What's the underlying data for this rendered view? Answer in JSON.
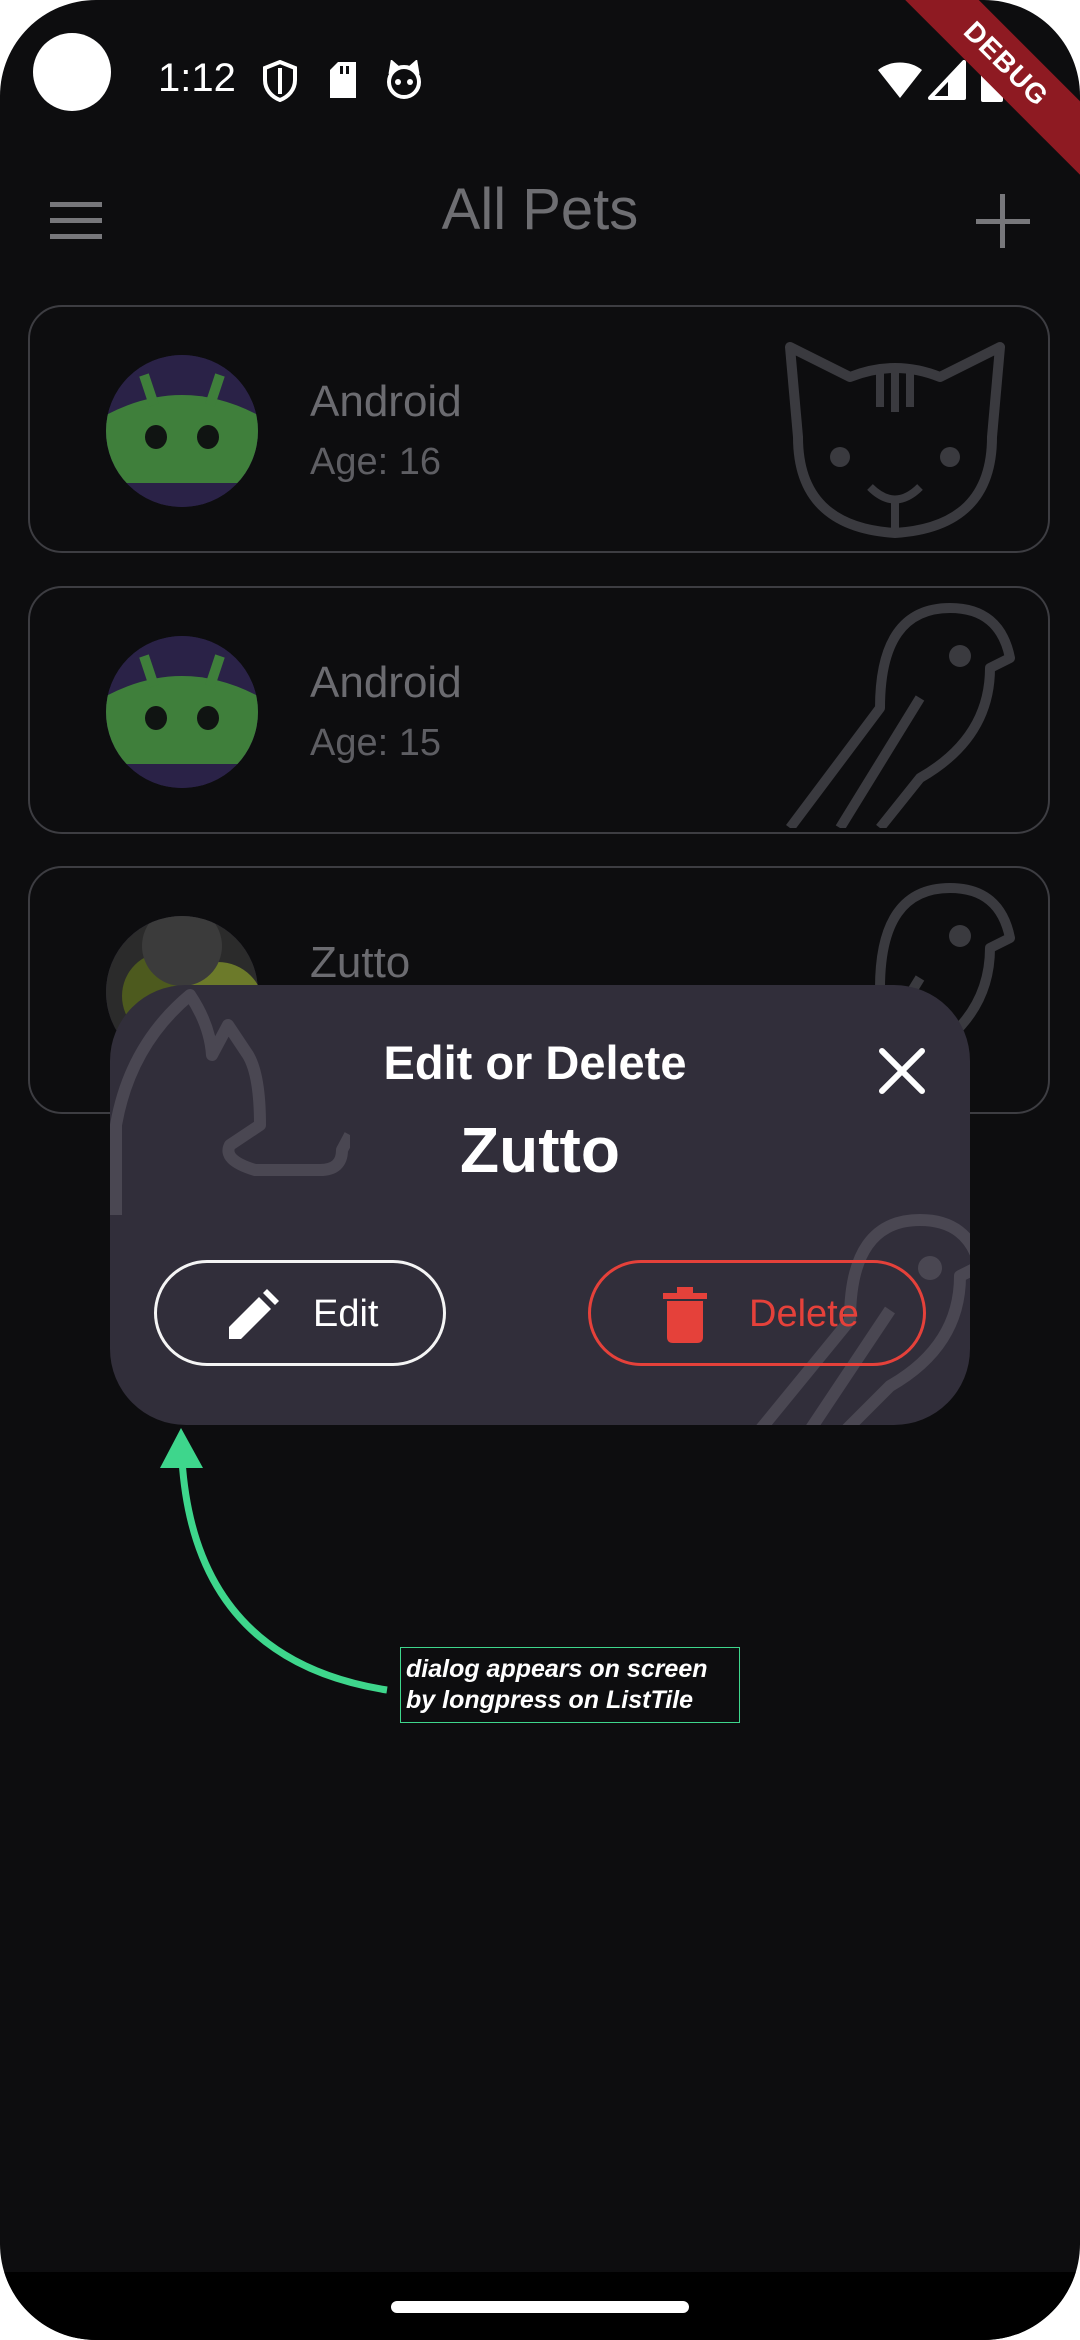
{
  "status_bar": {
    "time": "1:12",
    "debug_banner": "DEBUG"
  },
  "app_bar": {
    "title": "All Pets"
  },
  "pets": [
    {
      "name": "Android",
      "age": "Age: 16",
      "type_icon": "cat-outline-icon"
    },
    {
      "name": "Android",
      "age": "Age: 15",
      "type_icon": "bird-outline-icon"
    },
    {
      "name": "Zutto",
      "age": "",
      "type_icon": "bird-outline-icon"
    }
  ],
  "dialog": {
    "title": "Edit or Delete",
    "pet_name": "Zutto",
    "edit_label": "Edit",
    "delete_label": "Delete"
  },
  "annotation": {
    "line1": "dialog appears on screen",
    "line2": "by longpress on ListTile"
  },
  "colors": {
    "background": "#0d0d0f",
    "dialog": "#312e3a",
    "delete": "#e5413a",
    "annotation": "#3ed68c",
    "debug_banner": "#8e1a22"
  }
}
